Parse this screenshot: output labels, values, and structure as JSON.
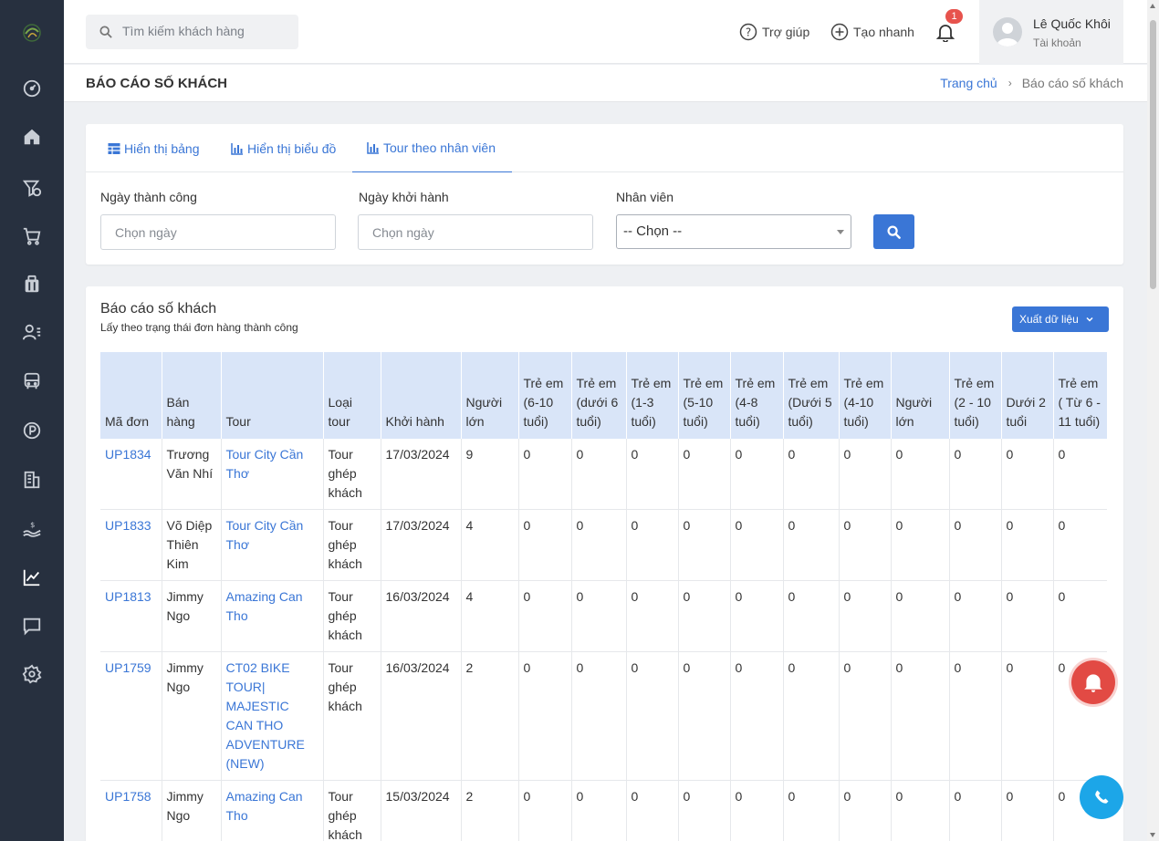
{
  "header": {
    "search_placeholder": "Tìm kiếm khách hàng",
    "help_label": "Trợ giúp",
    "quick_create_label": "Tạo nhanh",
    "notification_count": "1",
    "user_name": "Lê Quốc Khôi",
    "user_sub": "Tài khoản"
  },
  "page": {
    "title": "BÁO CÁO SỐ KHÁCH",
    "breadcrumb_home": "Trang chủ",
    "breadcrumb_current": "Báo cáo số khách"
  },
  "tabs": [
    {
      "label": "Hiển thị bảng",
      "icon": "table-icon"
    },
    {
      "label": "Hiển thị biểu đồ",
      "icon": "bar-chart-icon"
    },
    {
      "label": "Tour theo nhân viên",
      "icon": "bar-chart-icon",
      "active": true
    }
  ],
  "filters": {
    "success_date_label": "Ngày thành công",
    "success_date_placeholder": "Chọn ngày",
    "departure_date_label": "Ngày khởi hành",
    "departure_date_placeholder": "Chọn ngày",
    "staff_label": "Nhân viên",
    "staff_selected": "-- Chọn --"
  },
  "report": {
    "title": "Báo cáo số khách",
    "subtitle": "Lấy theo trạng thái đơn hàng thành công",
    "export_label": "Xuất dữ liệu",
    "columns": [
      "Mã đơn",
      "Bán hàng",
      "Tour",
      "Loại tour",
      "Khởi hành",
      "Người lớn",
      "Trẻ em (6-10 tuổi)",
      "Trẻ em (dưới 6 tuổi)",
      "Trẻ em (1-3 tuổi)",
      "Trẻ em (5-10 tuổi)",
      "Trẻ em (4-8 tuổi)",
      "Trẻ em (Dưới 5 tuổi)",
      "Trẻ em (4-10 tuổi)",
      "Người lớn",
      "Trẻ em (2 - 10 tuổi)",
      "Dưới 2 tuổi",
      "Trẻ em ( Từ 6 - 11 tuổi)"
    ],
    "rows": [
      [
        "UP1834",
        "Trương Văn Nhí",
        "Tour City Cần Thơ",
        "Tour ghép khách",
        "17/03/2024",
        "9",
        "0",
        "0",
        "0",
        "0",
        "0",
        "0",
        "0",
        "0",
        "0",
        "0",
        "0"
      ],
      [
        "UP1833",
        "Võ Diệp Thiên Kim",
        "Tour City Cần Thơ",
        "Tour ghép khách",
        "17/03/2024",
        "4",
        "0",
        "0",
        "0",
        "0",
        "0",
        "0",
        "0",
        "0",
        "0",
        "0",
        "0"
      ],
      [
        "UP1813",
        "Jimmy Ngo",
        "Amazing Can Tho",
        "Tour ghép khách",
        "16/03/2024",
        "4",
        "0",
        "0",
        "0",
        "0",
        "0",
        "0",
        "0",
        "0",
        "0",
        "0",
        "0"
      ],
      [
        "UP1759",
        "Jimmy Ngo",
        "CT02 BIKE TOUR| MAJESTIC CAN THO ADVENTURE (NEW)",
        "Tour ghép khách",
        "16/03/2024",
        "2",
        "0",
        "0",
        "0",
        "0",
        "0",
        "0",
        "0",
        "0",
        "0",
        "0",
        "0"
      ],
      [
        "UP1758",
        "Jimmy Ngo",
        "Amazing Can Tho",
        "Tour ghép khách",
        "15/03/2024",
        "2",
        "0",
        "0",
        "0",
        "0",
        "0",
        "0",
        "0",
        "0",
        "0",
        "0",
        "0"
      ]
    ]
  },
  "sidebar": {
    "items": [
      "dashboard-icon",
      "home-icon",
      "funnel-money-icon",
      "cart-icon",
      "briefcase-icon",
      "users-list-icon",
      "bus-icon",
      "parking-icon",
      "building-icon",
      "hand-money-icon",
      "line-chart-icon",
      "chat-icon",
      "settings-icon"
    ]
  },
  "colors": {
    "sidebar_bg": "#27303f",
    "accent": "#3a76d6",
    "table_header_bg": "#d9e5f8",
    "notification_red": "#e24a44",
    "phone_blue": "#1ca6e8"
  }
}
